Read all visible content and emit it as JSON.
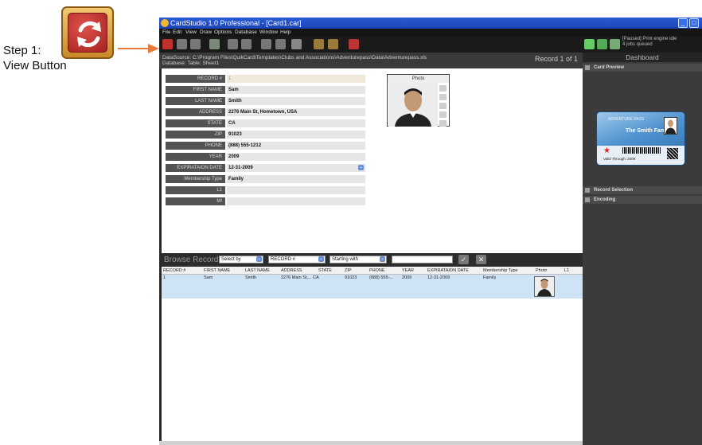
{
  "callout": {
    "line1": "Step 1:",
    "line2": "View Button"
  },
  "window": {
    "title": "CardStudio 1.0 Professional - [Card1.car]",
    "controls": [
      "_",
      "□"
    ]
  },
  "menu": [
    "File",
    "Edit",
    "View",
    "Draw",
    "Options",
    "Database",
    "Window",
    "Help"
  ],
  "status": {
    "line1": "[Paused] Print engine idle",
    "line2": "4 jobs queued"
  },
  "info": {
    "datasource": "DataSource: C:\\Program Files\\QuikCard\\Templates\\Clubs and Associations\\Adventurepass\\Data\\Adventurepass.xls",
    "database": "Database:        Table: Sheet1",
    "record": "Record 1 of 1"
  },
  "form": {
    "fields": [
      {
        "label": "RECORD #",
        "value": "1"
      },
      {
        "label": "FIRST NAME",
        "value": "Sam"
      },
      {
        "label": "LAST NAME",
        "value": "Smith"
      },
      {
        "label": "ADDRESS",
        "value": "2276 Main St, Hometown, USA"
      },
      {
        "label": "STATE",
        "value": "CA"
      },
      {
        "label": "ZIP",
        "value": "91023"
      },
      {
        "label": "PHONE",
        "value": "(888) 555-1212"
      },
      {
        "label": "YEAR",
        "value": "2009"
      },
      {
        "label": "EXPIRATAION DATE",
        "value": "12-31-2009"
      },
      {
        "label": "Membership Type",
        "value": "Family"
      },
      {
        "label": "L1",
        "value": ""
      },
      {
        "label": "MI",
        "value": ""
      }
    ],
    "photo_label": "Photo"
  },
  "browse": {
    "title": "Browse Records",
    "select_by": "Select by",
    "field": "RECORD #",
    "match": "Starting with",
    "search_value": "",
    "columns": [
      "RECORD #",
      "FIRST NAME",
      "LAST NAME",
      "ADDRESS",
      "STATE",
      "ZIP",
      "PHONE",
      "YEAR",
      "EXPIRATAION DATE",
      "Membership Type",
      "Photo",
      "L1"
    ],
    "rows": [
      [
        "1",
        "Sam",
        "Smith",
        "2276 Main St,... CA",
        "",
        "91023",
        "(888) 555-...",
        "2009",
        "12-31-2009",
        "Family",
        "",
        ""
      ]
    ]
  },
  "dashboard": {
    "title": "Dashboard",
    "sections": [
      "Card Preview",
      "Record Selection",
      "Encoding"
    ],
    "card": {
      "header": "ADVENTURE PASS",
      "family": "The Smith Family",
      "valid": "Valid Through: 2009"
    }
  },
  "colors": {
    "titlebar": "#2a5bd6",
    "dark_ui": "#2a2a2a",
    "view_button": "#c2302c",
    "arrow": "#e8793a"
  }
}
